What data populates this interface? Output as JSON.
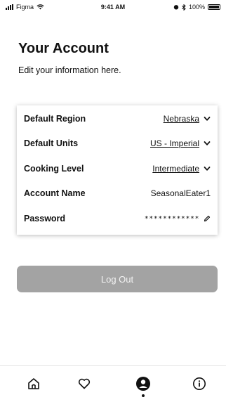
{
  "status_bar": {
    "carrier": "Figma",
    "time": "9:41 AM",
    "battery": "100%"
  },
  "header": {
    "title": "Your Account",
    "subtitle": "Edit your information here."
  },
  "settings": {
    "region": {
      "label": "Default Region",
      "value": "Nebraska"
    },
    "units": {
      "label": "Default Units",
      "value": "US - Imperial"
    },
    "cooking": {
      "label": "Cooking Level",
      "value": "Intermediate"
    },
    "account": {
      "label": "Account Name",
      "value": "SeasonalEater1"
    },
    "password": {
      "label": "Password",
      "value": "************"
    }
  },
  "logout_label": "Log Out",
  "tab_bar": {
    "tabs": [
      "home-icon",
      "heart-icon",
      "user-icon",
      "info-icon"
    ],
    "active": "user-icon"
  },
  "colors": {
    "logout_bg": "#a3a3a3",
    "text": "#111111"
  }
}
